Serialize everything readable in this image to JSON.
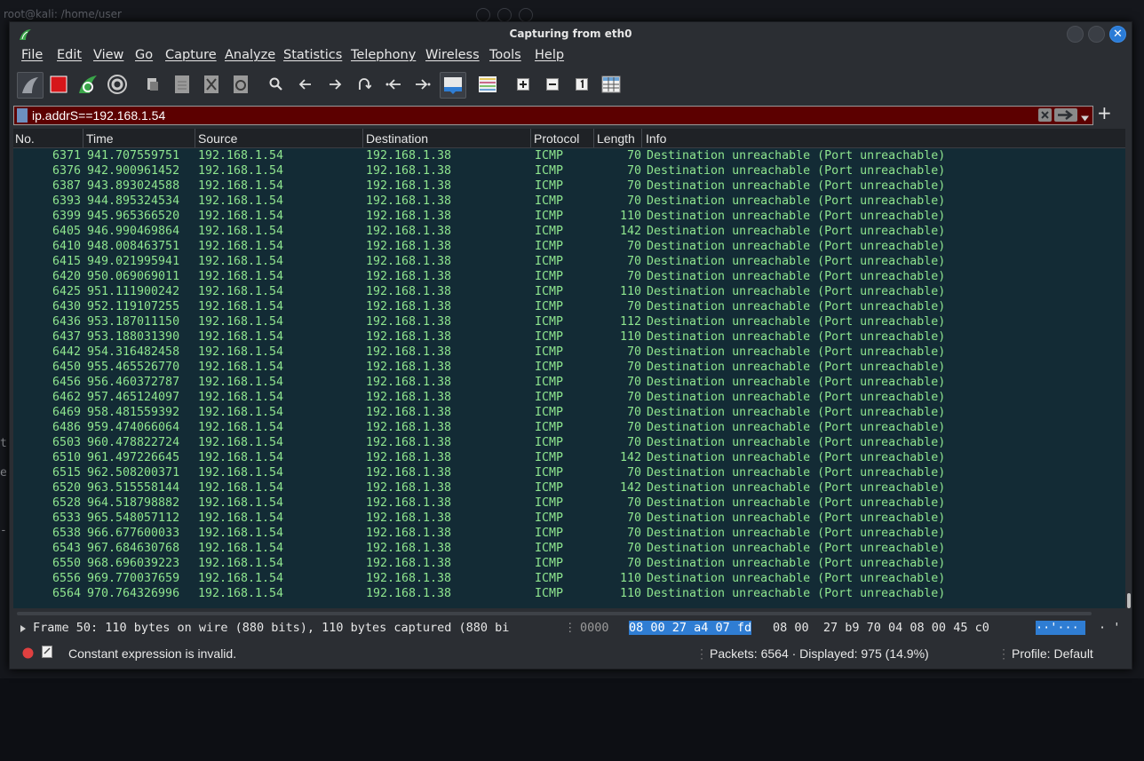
{
  "background": {
    "terminal_title": "root@kali: /home/user",
    "left_chars": [
      "t",
      "e",
      "-"
    ]
  },
  "window": {
    "title": "Capturing from eth0"
  },
  "menu": [
    "File",
    "Edit",
    "View",
    "Go",
    "Capture",
    "Analyze",
    "Statistics",
    "Telephony",
    "Wireless",
    "Tools",
    "Help"
  ],
  "toolbar_icons": [
    "shark-fin-icon",
    "stop-icon",
    "restart-icon",
    "options-gear-icon",
    "open-file-icon",
    "save-file-icon",
    "close-file-icon",
    "reload-icon",
    "find-icon",
    "back-arrow-icon",
    "forward-arrow-icon",
    "go-to-packet-icon",
    "first-packet-icon",
    "last-packet-icon",
    "autoscroll-icon",
    "colorize-icon",
    "zoom-in-icon",
    "zoom-out-icon",
    "normal-size-icon",
    "resize-columns-icon"
  ],
  "filter": {
    "value": "ip.addrS==192.168.1.54",
    "bg_color": "#5c0000"
  },
  "columns": [
    "No.",
    "Time",
    "Source",
    "Destination",
    "Protocol",
    "Length",
    "Info"
  ],
  "packets": [
    {
      "no": "6371",
      "time": "941.707559751",
      "src": "192.168.1.54",
      "dst": "192.168.1.38",
      "proto": "ICMP",
      "len": "70",
      "info": "Destination unreachable (Port unreachable)"
    },
    {
      "no": "6376",
      "time": "942.900961452",
      "src": "192.168.1.54",
      "dst": "192.168.1.38",
      "proto": "ICMP",
      "len": "70",
      "info": "Destination unreachable (Port unreachable)"
    },
    {
      "no": "6387",
      "time": "943.893024588",
      "src": "192.168.1.54",
      "dst": "192.168.1.38",
      "proto": "ICMP",
      "len": "70",
      "info": "Destination unreachable (Port unreachable)"
    },
    {
      "no": "6393",
      "time": "944.895324534",
      "src": "192.168.1.54",
      "dst": "192.168.1.38",
      "proto": "ICMP",
      "len": "70",
      "info": "Destination unreachable (Port unreachable)"
    },
    {
      "no": "6399",
      "time": "945.965366520",
      "src": "192.168.1.54",
      "dst": "192.168.1.38",
      "proto": "ICMP",
      "len": "110",
      "info": "Destination unreachable (Port unreachable)"
    },
    {
      "no": "6405",
      "time": "946.990469864",
      "src": "192.168.1.54",
      "dst": "192.168.1.38",
      "proto": "ICMP",
      "len": "142",
      "info": "Destination unreachable (Port unreachable)"
    },
    {
      "no": "6410",
      "time": "948.008463751",
      "src": "192.168.1.54",
      "dst": "192.168.1.38",
      "proto": "ICMP",
      "len": "70",
      "info": "Destination unreachable (Port unreachable)"
    },
    {
      "no": "6415",
      "time": "949.021995941",
      "src": "192.168.1.54",
      "dst": "192.168.1.38",
      "proto": "ICMP",
      "len": "70",
      "info": "Destination unreachable (Port unreachable)"
    },
    {
      "no": "6420",
      "time": "950.069069011",
      "src": "192.168.1.54",
      "dst": "192.168.1.38",
      "proto": "ICMP",
      "len": "70",
      "info": "Destination unreachable (Port unreachable)"
    },
    {
      "no": "6425",
      "time": "951.111900242",
      "src": "192.168.1.54",
      "dst": "192.168.1.38",
      "proto": "ICMP",
      "len": "110",
      "info": "Destination unreachable (Port unreachable)"
    },
    {
      "no": "6430",
      "time": "952.119107255",
      "src": "192.168.1.54",
      "dst": "192.168.1.38",
      "proto": "ICMP",
      "len": "70",
      "info": "Destination unreachable (Port unreachable)"
    },
    {
      "no": "6436",
      "time": "953.187011150",
      "src": "192.168.1.54",
      "dst": "192.168.1.38",
      "proto": "ICMP",
      "len": "112",
      "info": "Destination unreachable (Port unreachable)"
    },
    {
      "no": "6437",
      "time": "953.188031390",
      "src": "192.168.1.54",
      "dst": "192.168.1.38",
      "proto": "ICMP",
      "len": "110",
      "info": "Destination unreachable (Port unreachable)"
    },
    {
      "no": "6442",
      "time": "954.316482458",
      "src": "192.168.1.54",
      "dst": "192.168.1.38",
      "proto": "ICMP",
      "len": "70",
      "info": "Destination unreachable (Port unreachable)"
    },
    {
      "no": "6450",
      "time": "955.465526770",
      "src": "192.168.1.54",
      "dst": "192.168.1.38",
      "proto": "ICMP",
      "len": "70",
      "info": "Destination unreachable (Port unreachable)"
    },
    {
      "no": "6456",
      "time": "956.460372787",
      "src": "192.168.1.54",
      "dst": "192.168.1.38",
      "proto": "ICMP",
      "len": "70",
      "info": "Destination unreachable (Port unreachable)"
    },
    {
      "no": "6462",
      "time": "957.465124097",
      "src": "192.168.1.54",
      "dst": "192.168.1.38",
      "proto": "ICMP",
      "len": "70",
      "info": "Destination unreachable (Port unreachable)"
    },
    {
      "no": "6469",
      "time": "958.481559392",
      "src": "192.168.1.54",
      "dst": "192.168.1.38",
      "proto": "ICMP",
      "len": "70",
      "info": "Destination unreachable (Port unreachable)"
    },
    {
      "no": "6486",
      "time": "959.474066064",
      "src": "192.168.1.54",
      "dst": "192.168.1.38",
      "proto": "ICMP",
      "len": "70",
      "info": "Destination unreachable (Port unreachable)"
    },
    {
      "no": "6503",
      "time": "960.478822724",
      "src": "192.168.1.54",
      "dst": "192.168.1.38",
      "proto": "ICMP",
      "len": "70",
      "info": "Destination unreachable (Port unreachable)"
    },
    {
      "no": "6510",
      "time": "961.497226645",
      "src": "192.168.1.54",
      "dst": "192.168.1.38",
      "proto": "ICMP",
      "len": "142",
      "info": "Destination unreachable (Port unreachable)"
    },
    {
      "no": "6515",
      "time": "962.508200371",
      "src": "192.168.1.54",
      "dst": "192.168.1.38",
      "proto": "ICMP",
      "len": "70",
      "info": "Destination unreachable (Port unreachable)"
    },
    {
      "no": "6520",
      "time": "963.515558144",
      "src": "192.168.1.54",
      "dst": "192.168.1.38",
      "proto": "ICMP",
      "len": "142",
      "info": "Destination unreachable (Port unreachable)"
    },
    {
      "no": "6528",
      "time": "964.518798882",
      "src": "192.168.1.54",
      "dst": "192.168.1.38",
      "proto": "ICMP",
      "len": "70",
      "info": "Destination unreachable (Port unreachable)"
    },
    {
      "no": "6533",
      "time": "965.548057112",
      "src": "192.168.1.54",
      "dst": "192.168.1.38",
      "proto": "ICMP",
      "len": "70",
      "info": "Destination unreachable (Port unreachable)"
    },
    {
      "no": "6538",
      "time": "966.677600033",
      "src": "192.168.1.54",
      "dst": "192.168.1.38",
      "proto": "ICMP",
      "len": "70",
      "info": "Destination unreachable (Port unreachable)"
    },
    {
      "no": "6543",
      "time": "967.684630768",
      "src": "192.168.1.54",
      "dst": "192.168.1.38",
      "proto": "ICMP",
      "len": "70",
      "info": "Destination unreachable (Port unreachable)"
    },
    {
      "no": "6550",
      "time": "968.696039223",
      "src": "192.168.1.54",
      "dst": "192.168.1.38",
      "proto": "ICMP",
      "len": "70",
      "info": "Destination unreachable (Port unreachable)"
    },
    {
      "no": "6556",
      "time": "969.770037659",
      "src": "192.168.1.54",
      "dst": "192.168.1.38",
      "proto": "ICMP",
      "len": "110",
      "info": "Destination unreachable (Port unreachable)"
    },
    {
      "no": "6564",
      "time": "970.764326996",
      "src": "192.168.1.54",
      "dst": "192.168.1.38",
      "proto": "ICMP",
      "len": "110",
      "info": "Destination unreachable (Port unreachable)"
    }
  ],
  "detail": {
    "frame_text": "Frame 50: 110 bytes on wire (880 bits), 110 bytes captured (880 bi"
  },
  "hex": {
    "offset": "0000",
    "selected_bytes": "08 00 27 a4 07 fd",
    "rest_bytes": "08 00  27 b9 70 04 08 00 45 c0",
    "ascii_selected": "··'···",
    "ascii_rest": "· '"
  },
  "status": {
    "message": "Constant expression is invalid.",
    "packets": "Packets: 6564 · Displayed: 975 (14.9%)",
    "profile": "Profile: Default"
  },
  "colors": {
    "row_bg": "#132b35",
    "row_fg": "#8fe68f",
    "filter_invalid": "#5c0000",
    "selection": "#2f7dd3"
  }
}
